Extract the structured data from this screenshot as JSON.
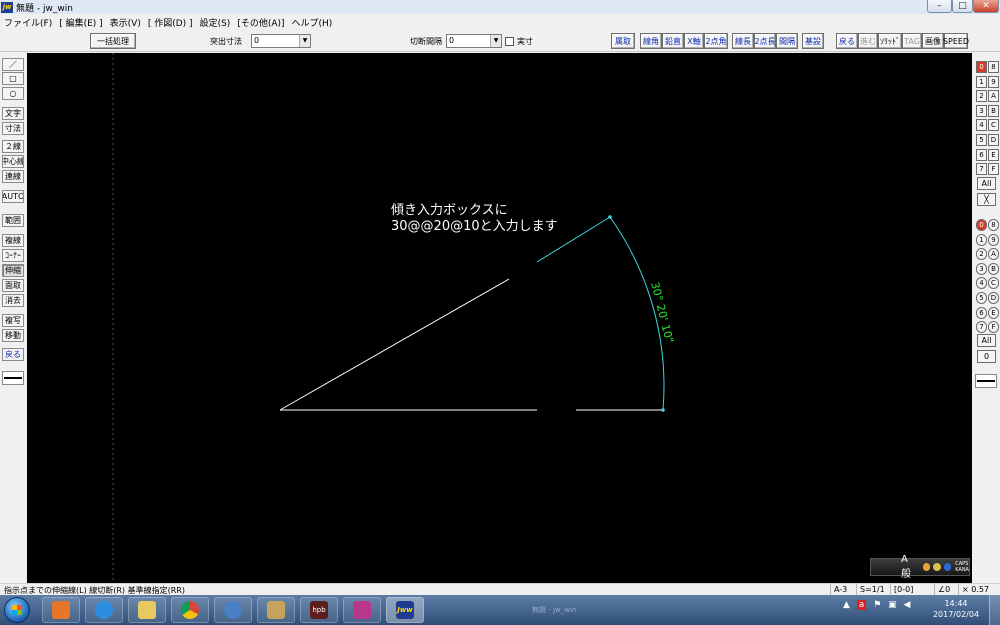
{
  "window": {
    "app_icon_text": "jw",
    "title": "無題 - jw_win",
    "minimize_glyph": "–",
    "maximize_glyph": "□",
    "close_glyph": "✕"
  },
  "menu": [
    "ファイル(F)",
    "[ 編集(E) ]",
    "表示(V)",
    "[ 作図(D) ]",
    "設定(S)",
    "[その他(A)]",
    "ヘルプ(H)"
  ],
  "toolbar": {
    "batch_button": "一括処理",
    "protrude_label": "突出寸法",
    "protrude_value": "0",
    "cut_gap_label": "切断間隔",
    "cut_gap_value": "0",
    "actual_size_label": "実寸",
    "mode_buttons": [
      "属取",
      "線角",
      "鉛直",
      "X軸",
      "2点角",
      "線長",
      "2点長",
      "間隔",
      "基設"
    ],
    "right_buttons": [
      "戻る",
      "進む",
      "ｿﾘｯﾄﾞ",
      "TAG",
      "画像",
      "SPEED"
    ]
  },
  "left_tools": [
    "／",
    "□",
    "○",
    "文字",
    "寸法",
    "２線",
    "中心線",
    "連線",
    "AUTO",
    "範囲",
    "複線",
    "ｺｰﾅｰ",
    "伸縮",
    "面取",
    "消去",
    "複写",
    "移動",
    "戻る"
  ],
  "right_layers": {
    "col1": [
      "0",
      "1",
      "2",
      "3",
      "4",
      "5",
      "6",
      "7"
    ],
    "col2": [
      "8",
      "9",
      "A",
      "B",
      "C",
      "D",
      "E",
      "F"
    ],
    "all_label": "All",
    "cross_glyph": "╳",
    "group_col1": [
      "0",
      "1",
      "2",
      "3",
      "4",
      "5",
      "6",
      "7"
    ],
    "group_col2": [
      "8",
      "9",
      "A",
      "B",
      "C",
      "D",
      "E",
      "F"
    ],
    "group_all_label": "All",
    "group_zero_label": "0"
  },
  "canvas": {
    "annotation_line1": "傾き入力ボックスに",
    "annotation_line2": "30@@20@10と入力します",
    "angle_label": "30° 20' 10\"",
    "line_color": "#ffffff",
    "arc_color": "#3fd4df",
    "dim_text_color": "#2ee52e"
  },
  "ime_bar": {
    "text": "A 般",
    "chip1": "CAPS",
    "chip2": "KANA"
  },
  "status": {
    "message": "指示点までの伸縮線(L)  線切断(R)  基準線指定(RR)",
    "paper": "A-3",
    "scale": "S=1/1",
    "layer": "[0-0]",
    "angle": "∠0",
    "zoom": "× 0.57"
  },
  "taskbar": {
    "apps": [
      "media-player",
      "internet-explorer",
      "file-explorer",
      "chrome",
      "thunderbird",
      "paint",
      "hpb",
      "game",
      "jw-cad"
    ],
    "hpb_label": "hpb",
    "jw_label": "Jww",
    "preview_text": "無題 - jw_win",
    "time": "14:44",
    "date": "2017/02/04"
  }
}
